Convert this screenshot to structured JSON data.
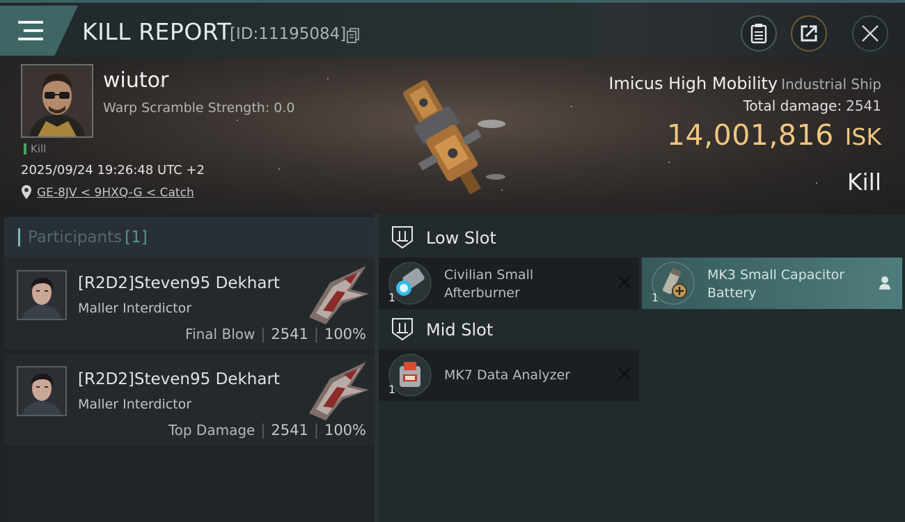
{
  "header": {
    "title": "KILL REPORT",
    "report_id": "[ID:11195084]",
    "icons": [
      "menu-icon",
      "copy-icon",
      "report-icon",
      "share-icon",
      "close-icon"
    ]
  },
  "victim": {
    "name": "wiutor",
    "warp_scramble": "Warp Scramble Strength: 0.0",
    "kill_tag": "Kill",
    "timestamp": "2025/09/24 19:26:48 UTC +2",
    "location": "GE-8JV < 9HXQ-G < Catch",
    "ship_name": "Imicus High Mobility",
    "ship_class": "Industrial Ship",
    "total_damage_label": "Total damage:",
    "total_damage": "2541",
    "isk_value": "14,001,816",
    "isk_unit": "ISK",
    "result": "Kill"
  },
  "participants": {
    "label": "Participants",
    "count": "[1]",
    "rows": [
      {
        "name": "[R2D2]Steven95 Dekhart",
        "ship": "Maller Interdictor",
        "tag": "Final Blow",
        "damage": "2541",
        "percent": "100%"
      },
      {
        "name": "[R2D2]Steven95 Dekhart",
        "ship": "Maller Interdictor",
        "tag": "Top Damage",
        "damage": "2541",
        "percent": "100%"
      }
    ]
  },
  "fittings": {
    "low_slot": {
      "label": "Low Slot",
      "modules": [
        {
          "name": "Civilian Small Afterburner",
          "qty": "1",
          "state": "destroyed"
        },
        {
          "name": "MK3 Small Capacitor Battery",
          "qty": "1",
          "state": "dropped"
        }
      ]
    },
    "mid_slot": {
      "label": "Mid Slot",
      "modules": [
        {
          "name": "MK7 Data Analyzer",
          "qty": "1",
          "state": "destroyed"
        }
      ]
    }
  },
  "colors": {
    "accent_teal": "#3f6664",
    "isk_gold": "#efc67f",
    "kill_green": "#4aa060",
    "dropped_highlight": "#4f7d7c"
  }
}
